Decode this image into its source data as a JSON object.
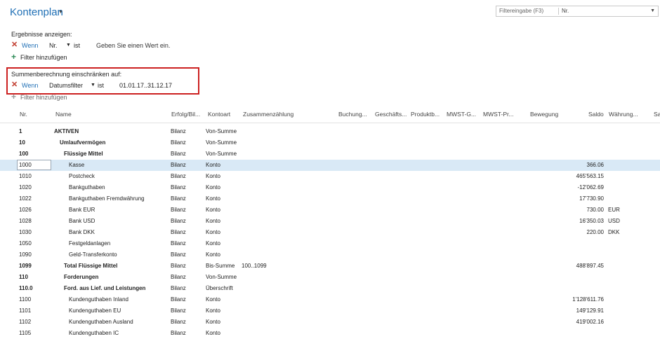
{
  "page": {
    "title": "Kontenplan"
  },
  "search": {
    "label": "Filtereingabe (F3)",
    "value": "Nr."
  },
  "results": {
    "heading": "Ergebnisse anzeigen:",
    "condition": {
      "when": "Wenn",
      "field": "Nr.",
      "op": "ist",
      "value": "Geben Sie einen Wert ein."
    },
    "add_filter": "Filter hinzufügen"
  },
  "sum_limit": {
    "heading": "Summenberechnung einschränken auf:",
    "condition": {
      "when": "Wenn",
      "field": "Datumsfilter",
      "op": "ist",
      "value": "01.01.17..31.12.17"
    },
    "add_filter": "Filter hinzufügen"
  },
  "table": {
    "columns": [
      "Nr.",
      "Name",
      "Erfolg/Bil...",
      "Kontoart",
      "Zusammenzählung",
      "Buchung...",
      "Geschäfts...",
      "Produktb...",
      "MWST-G...",
      "MWST-Pr...",
      "Bewegung",
      "Saldo",
      "Währung...",
      "Sa"
    ],
    "rows": [
      {
        "nr": "1",
        "name": "AKTIVEN",
        "erfolg": "Bilanz",
        "kontoart": "Von-Summe",
        "zus": "",
        "saldo": "",
        "waehrung": "",
        "bold": true,
        "indent": 0
      },
      {
        "nr": "10",
        "name": "Umlaufvermögen",
        "erfolg": "Bilanz",
        "kontoart": "Von-Summe",
        "zus": "",
        "saldo": "",
        "waehrung": "",
        "bold": true,
        "indent": 1
      },
      {
        "nr": "100",
        "name": "Flüssige Mittel",
        "erfolg": "Bilanz",
        "kontoart": "Von-Summe",
        "zus": "",
        "saldo": "",
        "waehrung": "",
        "bold": true,
        "indent": 2
      },
      {
        "nr": "1000",
        "name": "Kasse",
        "erfolg": "Bilanz",
        "kontoart": "Konto",
        "zus": "",
        "saldo": "366.06",
        "waehrung": "",
        "bold": false,
        "indent": 3,
        "selected": true
      },
      {
        "nr": "1010",
        "name": "Postcheck",
        "erfolg": "Bilanz",
        "kontoart": "Konto",
        "zus": "",
        "saldo": "465'563.15",
        "waehrung": "",
        "bold": false,
        "indent": 3
      },
      {
        "nr": "1020",
        "name": "Bankguthaben",
        "erfolg": "Bilanz",
        "kontoart": "Konto",
        "zus": "",
        "saldo": "-12'062.69",
        "waehrung": "",
        "bold": false,
        "indent": 3
      },
      {
        "nr": "1022",
        "name": "Bankguthaben Fremdwährung",
        "erfolg": "Bilanz",
        "kontoart": "Konto",
        "zus": "",
        "saldo": "17'730.90",
        "waehrung": "",
        "bold": false,
        "indent": 3
      },
      {
        "nr": "1026",
        "name": "Bank EUR",
        "erfolg": "Bilanz",
        "kontoart": "Konto",
        "zus": "",
        "saldo": "730.00",
        "waehrung": "EUR",
        "bold": false,
        "indent": 3
      },
      {
        "nr": "1028",
        "name": "Bank USD",
        "erfolg": "Bilanz",
        "kontoart": "Konto",
        "zus": "",
        "saldo": "16'350.03",
        "waehrung": "USD",
        "bold": false,
        "indent": 3
      },
      {
        "nr": "1030",
        "name": "Bank DKK",
        "erfolg": "Bilanz",
        "kontoart": "Konto",
        "zus": "",
        "saldo": "220.00",
        "waehrung": "DKK",
        "bold": false,
        "indent": 3
      },
      {
        "nr": "1050",
        "name": "Festgeldanlagen",
        "erfolg": "Bilanz",
        "kontoart": "Konto",
        "zus": "",
        "saldo": "",
        "waehrung": "",
        "bold": false,
        "indent": 3
      },
      {
        "nr": "1090",
        "name": "Geld-Transferkonto",
        "erfolg": "Bilanz",
        "kontoart": "Konto",
        "zus": "",
        "saldo": "",
        "waehrung": "",
        "bold": false,
        "indent": 3
      },
      {
        "nr": "1099",
        "name": "Total Flüssige Mittel",
        "erfolg": "Bilanz",
        "kontoart": "Bis-Summe",
        "zus": "100..1099",
        "saldo": "488'897.45",
        "waehrung": "",
        "bold": true,
        "indent": 2
      },
      {
        "nr": "110",
        "name": "Forderungen",
        "erfolg": "Bilanz",
        "kontoart": "Von-Summe",
        "zus": "",
        "saldo": "",
        "waehrung": "",
        "bold": true,
        "indent": 2
      },
      {
        "nr": "110.0",
        "name": "Ford. aus Lief. und Leistungen",
        "erfolg": "Bilanz",
        "kontoart": "Überschrift",
        "zus": "",
        "saldo": "",
        "waehrung": "",
        "bold": true,
        "indent": 2
      },
      {
        "nr": "1100",
        "name": "Kundenguthaben Inland",
        "erfolg": "Bilanz",
        "kontoart": "Konto",
        "zus": "",
        "saldo": "1'128'611.76",
        "waehrung": "",
        "bold": false,
        "indent": 3
      },
      {
        "nr": "1101",
        "name": "Kundenguthaben EU",
        "erfolg": "Bilanz",
        "kontoart": "Konto",
        "zus": "",
        "saldo": "149'129.91",
        "waehrung": "",
        "bold": false,
        "indent": 3
      },
      {
        "nr": "1102",
        "name": "Kundenguthaben Ausland",
        "erfolg": "Bilanz",
        "kontoart": "Konto",
        "zus": "",
        "saldo": "419'002.16",
        "waehrung": "",
        "bold": false,
        "indent": 3
      },
      {
        "nr": "1105",
        "name": "Kundenguthaben IC",
        "erfolg": "Bilanz",
        "kontoart": "Konto",
        "zus": "",
        "saldo": "",
        "waehrung": "",
        "bold": false,
        "indent": 3
      }
    ]
  }
}
